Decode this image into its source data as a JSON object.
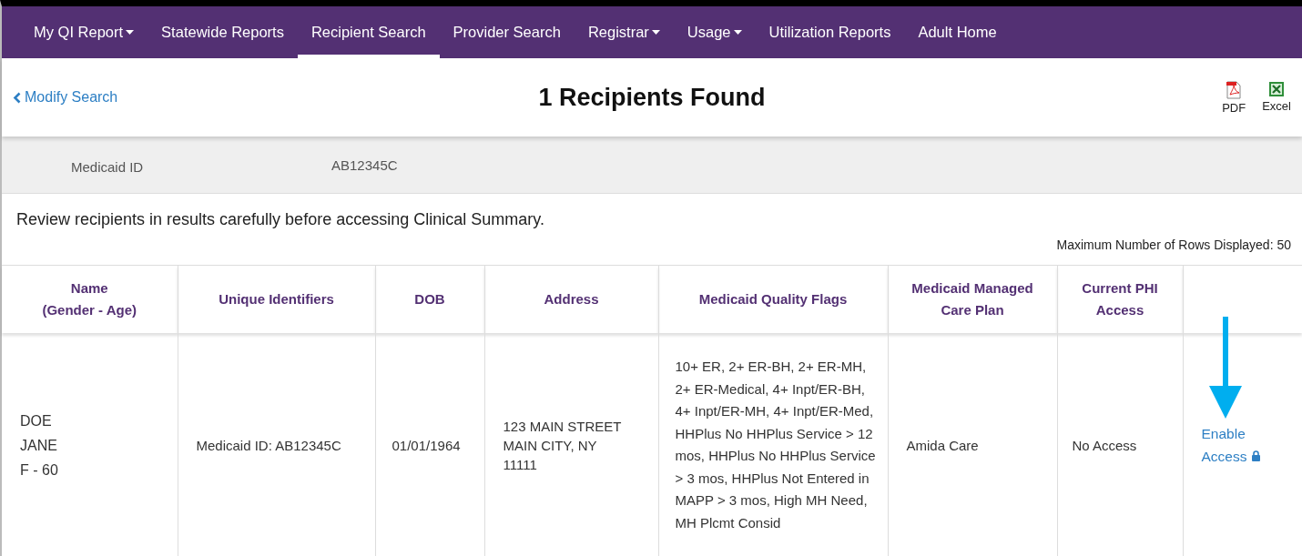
{
  "nav": [
    {
      "label": "My QI Report",
      "dropdown": true,
      "selected": false
    },
    {
      "label": "Statewide Reports",
      "dropdown": false,
      "selected": false
    },
    {
      "label": "Recipient Search",
      "dropdown": false,
      "selected": true
    },
    {
      "label": "Provider Search",
      "dropdown": false,
      "selected": false
    },
    {
      "label": "Registrar",
      "dropdown": true,
      "selected": false
    },
    {
      "label": "Usage",
      "dropdown": true,
      "selected": false
    },
    {
      "label": "Utilization Reports",
      "dropdown": false,
      "selected": false
    },
    {
      "label": "Adult Home",
      "dropdown": false,
      "selected": false
    }
  ],
  "header": {
    "back_link": "Modify Search",
    "title": "1 Recipients Found",
    "exports": [
      {
        "kind": "pdf",
        "label": "PDF"
      },
      {
        "kind": "excel",
        "label": "Excel"
      }
    ]
  },
  "criteria": {
    "label": "Medicaid ID",
    "value": "AB12345C"
  },
  "notice": "Review recipients in results carefully before accessing Clinical Summary.",
  "max_rows": "Maximum Number of Rows Displayed: 50",
  "table": {
    "columns": [
      [
        "Name",
        "(Gender - Age)"
      ],
      [
        "Unique Identifiers"
      ],
      [
        "DOB"
      ],
      [
        "Address"
      ],
      [
        "Medicaid Quality Flags"
      ],
      [
        "Medicaid Managed Care Plan"
      ],
      [
        "Current PHI Access"
      ]
    ],
    "rows": [
      {
        "name": [
          "DOE",
          "JANE",
          "F - 60"
        ],
        "identifiers": "Medicaid ID: AB12345C",
        "dob": "01/01/1964",
        "address": [
          "123 MAIN STREET",
          "MAIN CITY, NY",
          "11111"
        ],
        "flags": "10+ ER, 2+ ER-BH, 2+ ER-MH, 2+ ER-Medical, 4+ Inpt/ER-BH, 4+ Inpt/ER-MH, 4+ Inpt/ER-Med, HHPlus No HHPlus Service > 12 mos, HHPlus No HHPlus Service > 3 mos, HHPlus Not Entered in MAPP > 3 mos, High MH Need, MH Plcmt Consid",
        "plan": "Amida Care",
        "access": "No Access",
        "action": [
          "Enable",
          "Access"
        ]
      }
    ]
  }
}
